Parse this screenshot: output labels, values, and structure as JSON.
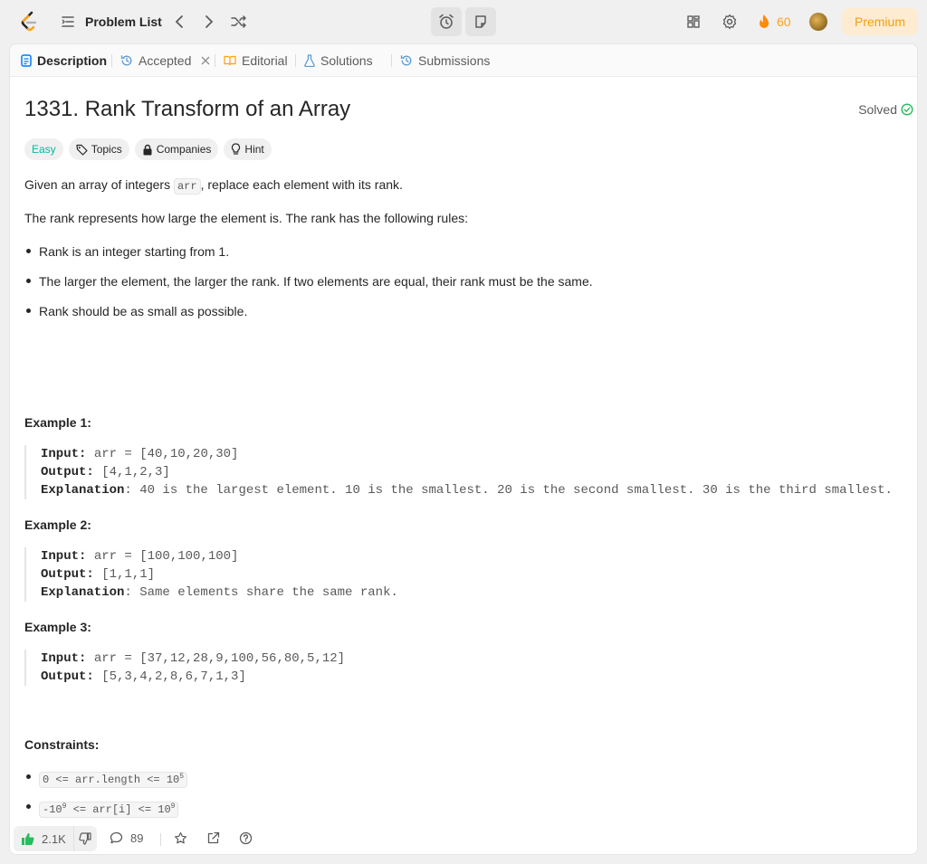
{
  "topbar": {
    "problem_list_label": "Problem List",
    "streak_count": "60",
    "premium_label": "Premium"
  },
  "tabs": {
    "description": "Description",
    "accepted": "Accepted",
    "editorial": "Editorial",
    "solutions": "Solutions",
    "submissions": "Submissions"
  },
  "problem": {
    "title": "1331. Rank Transform of an Array",
    "status": "Solved",
    "difficulty": "Easy",
    "chips": {
      "topics": "Topics",
      "companies": "Companies",
      "hint": "Hint"
    },
    "intro_before": "Given an array of integers ",
    "intro_code": "arr",
    "intro_after": ", replace each element with its rank.",
    "rules_intro": "The rank represents how large the element is. The rank has the following rules:",
    "rules": [
      "Rank is an integer starting from 1.",
      "The larger the element, the larger the rank. If two elements are equal, their rank must be the same.",
      "Rank should be as small as possible."
    ],
    "examples": [
      {
        "title": "Example 1:",
        "input": " arr = [40,10,20,30]",
        "output": " [4,1,2,3]",
        "explanation": ": 40 is the largest element. 10 is the smallest. 20 is the second smallest. 30 is the third smallest."
      },
      {
        "title": "Example 2:",
        "input": " arr = [100,100,100]",
        "output": " [1,1,1]",
        "explanation": ": Same elements share the same rank."
      },
      {
        "title": "Example 3:",
        "input": " arr = [37,12,28,9,100,56,80,5,12]",
        "output": " [5,3,4,2,8,6,7,1,3]"
      }
    ],
    "labels": {
      "input": "Input:",
      "output": "Output:",
      "explanation": "Explanation"
    },
    "constraints_title": "Constraints:",
    "constraints": [
      {
        "text": "0 <= arr.length <= 10",
        "sup": "5"
      },
      {
        "pre": "-10",
        "sup1": "9",
        "mid": " <= arr[i] <= 10",
        "sup2": "9"
      }
    ]
  },
  "footer": {
    "likes": "2.1K",
    "comments": "89"
  },
  "colors": {
    "accent": "#ffa116",
    "easy": "#00b8a3",
    "solved": "#2cbb5d",
    "like": "#2cbb5d"
  }
}
